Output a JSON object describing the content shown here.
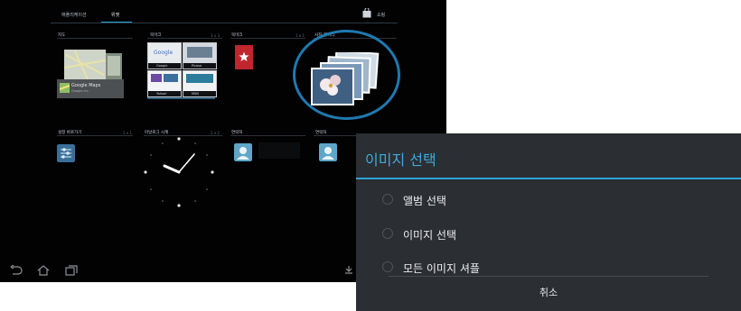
{
  "tablet": {
    "tabs": [
      "애플리케이션",
      "위젯"
    ],
    "shop_label": "쇼핑",
    "widgets": [
      {
        "label": "지도",
        "size": ""
      },
      {
        "label": "북마크",
        "size": "3 x 3"
      },
      {
        "label": "북마크",
        "size": "1 x 1"
      },
      {
        "label": "사진 갤러리",
        "size": ""
      },
      {
        "label": "설정 바로가기",
        "size": "1 x 1"
      },
      {
        "label": "아날로그 시계",
        "size": "2 x 2"
      },
      {
        "label": "연락처",
        "size": ""
      },
      {
        "label": "연락처",
        "size": ""
      }
    ],
    "maps_card": {
      "title": "Google Maps",
      "subtitle": "Google Inc."
    },
    "bookmarks": [
      "Google",
      "Picasa",
      "Yahoo!",
      "MSN"
    ]
  },
  "dialog": {
    "title": "이미지 선택",
    "options": [
      "앨범 선택",
      "이미지 선택",
      "모든 이미지 셔플"
    ],
    "cancel": "취소"
  },
  "colors": {
    "accent": "#33a5d9",
    "dialog_bg": "#2b2e32",
    "ring": "#1f79b0"
  }
}
